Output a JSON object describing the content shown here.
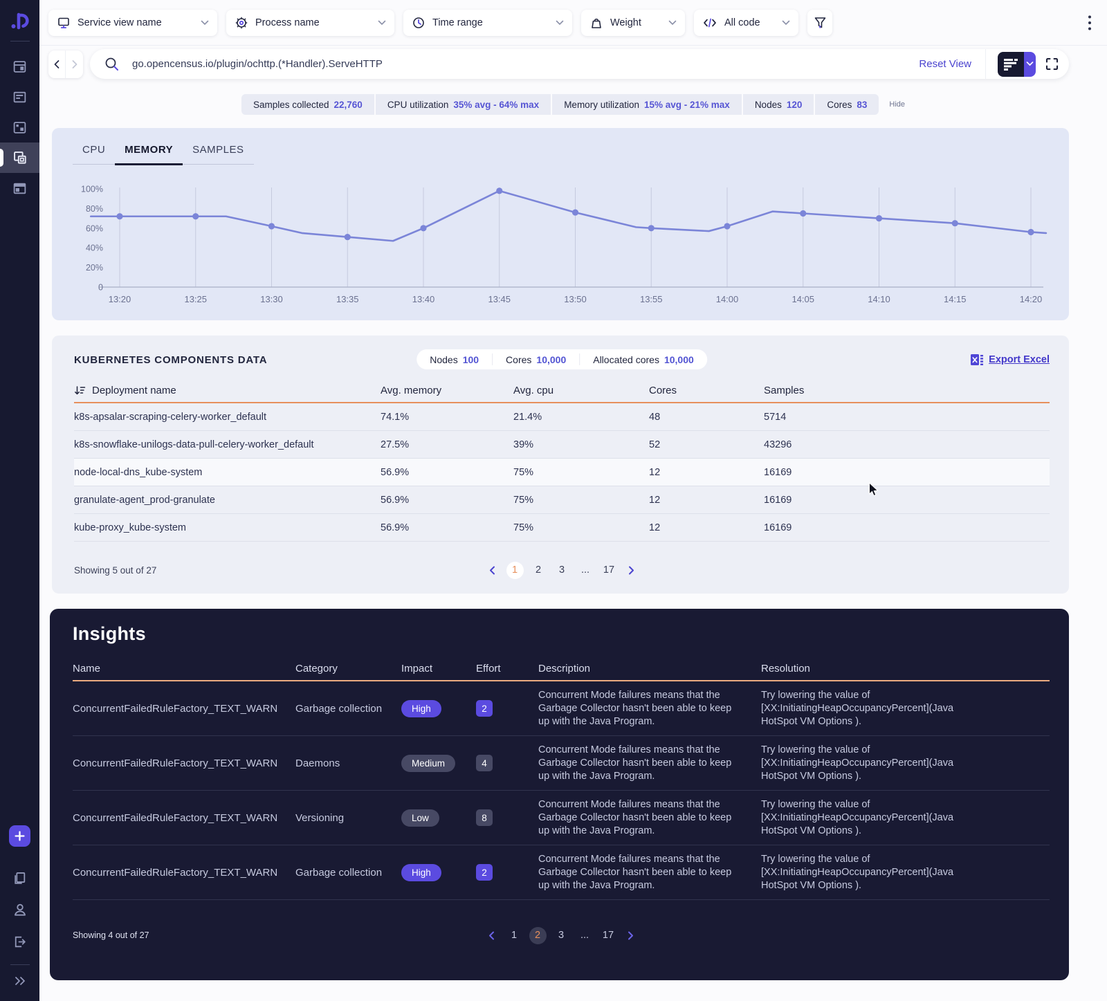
{
  "colors": {
    "accent_purple": "#5b4be0",
    "link_purple": "#4a43cf",
    "orange": "#e78f5c",
    "sidebar_navy": "#171930",
    "insights_bg": "#191a33",
    "chart_line": "#7b85d8",
    "stat_value_purple": "#5655d4"
  },
  "topbar": {
    "filters": [
      {
        "label": "Service view name",
        "icon": "monitor-icon"
      },
      {
        "label": "Process name",
        "icon": "gear-icon"
      },
      {
        "label": "Time range",
        "icon": "clock-icon"
      },
      {
        "label": "Weight",
        "icon": "weight-icon"
      },
      {
        "label": "All code",
        "icon": "code-icon"
      }
    ],
    "filter_button_icon": "funnel-icon",
    "menu_icon": "kebab-menu-icon"
  },
  "searchbar": {
    "query": "go.opencensus.io/plugin/ochttp.(*Handler).ServeHTTP",
    "reset_label": "Reset View"
  },
  "stats": {
    "items": [
      {
        "label": "Samples collected",
        "value": "22,760"
      },
      {
        "label": "CPU utilization",
        "value": "35% avg - 64% max"
      },
      {
        "label": "Memory utilization",
        "value": "15% avg - 21% max"
      },
      {
        "label": "Nodes",
        "value": "120"
      },
      {
        "label": "Cores",
        "value": "83"
      }
    ],
    "hide_label": "Hide"
  },
  "chart": {
    "tabs": [
      "CPU",
      "MEMORY",
      "SAMPLES"
    ],
    "active_tab": "MEMORY",
    "chart_data": {
      "type": "line",
      "series_name": "Memory utilization",
      "unit": "%",
      "ylim": [
        0,
        100
      ],
      "grid": "vertical",
      "line_color": "#7b85d8",
      "y_ticks": [
        {
          "label": "100%",
          "value": 100
        },
        {
          "label": "80%",
          "value": 80
        },
        {
          "label": "60%",
          "value": 60
        },
        {
          "label": "40%",
          "value": 40
        },
        {
          "label": "20%",
          "value": 20
        },
        {
          "label": "0",
          "value": 0
        }
      ],
      "x_ticks": [
        "13:20",
        "13:25",
        "13:30",
        "13:35",
        "13:40",
        "13:45",
        "13:50",
        "13:55",
        "14:00",
        "14:05",
        "14:10",
        "14:15",
        "14:20"
      ],
      "points": [
        {
          "t": "13:20",
          "v": 72
        },
        {
          "t": "13:25",
          "v": 72
        },
        {
          "t": "13:30",
          "v": 62
        },
        {
          "t": "13:35",
          "v": 51
        },
        {
          "t": "13:40",
          "v": 60
        },
        {
          "t": "13:45",
          "v": 98
        },
        {
          "t": "13:50",
          "v": 76
        },
        {
          "t": "13:55",
          "v": 60
        },
        {
          "t": "14:00",
          "v": 62
        },
        {
          "t": "14:05",
          "v": 75
        },
        {
          "t": "14:10",
          "v": 70
        },
        {
          "t": "14:15",
          "v": 65
        },
        {
          "t": "14:20",
          "v": 56
        }
      ],
      "polyline": [
        [
          -1.9,
          72,
          0
        ],
        [
          0,
          72,
          1
        ],
        [
          5,
          72,
          1
        ],
        [
          7,
          72,
          0
        ],
        [
          10,
          62,
          1
        ],
        [
          12,
          55,
          0
        ],
        [
          15,
          51,
          1
        ],
        [
          18,
          47,
          0
        ],
        [
          20,
          60,
          1
        ],
        [
          25,
          98,
          1
        ],
        [
          30,
          76,
          1
        ],
        [
          34,
          61,
          0
        ],
        [
          35,
          60,
          1
        ],
        [
          38.8,
          57,
          0
        ],
        [
          40,
          62,
          1
        ],
        [
          43,
          77,
          0
        ],
        [
          45,
          75,
          1
        ],
        [
          50,
          70,
          1
        ],
        [
          55,
          65,
          1
        ],
        [
          60,
          56,
          1
        ],
        [
          61,
          55,
          0
        ]
      ]
    }
  },
  "k8s": {
    "title": "KUBERNETES COMPONENTS DATA",
    "summary": [
      {
        "label": "Nodes",
        "value": "100"
      },
      {
        "label": "Cores",
        "value": "10,000"
      },
      {
        "label": "Allocated cores",
        "value": "10,000"
      }
    ],
    "export_label": "Export Excel",
    "columns": [
      "Deployment name",
      "Avg. memory",
      "Avg. cpu",
      "Cores",
      "Samples"
    ],
    "rows": [
      {
        "name": "k8s-apsalar-scraping-celery-worker_default",
        "memory": "74.1%",
        "cpu": "21.4%",
        "cores": "48",
        "samples": "5714",
        "highlight": false
      },
      {
        "name": "k8s-snowflake-unilogs-data-pull-celery-worker_default",
        "memory": "27.5%",
        "cpu": "39%",
        "cores": "52",
        "samples": "43296",
        "highlight": false
      },
      {
        "name": "node-local-dns_kube-system",
        "memory": "56.9%",
        "cpu": "75%",
        "cores": "12",
        "samples": "16169",
        "highlight": true
      },
      {
        "name": "granulate-agent_prod-granulate",
        "memory": "56.9%",
        "cpu": "75%",
        "cores": "12",
        "samples": "16169",
        "highlight": false
      },
      {
        "name": "kube-proxy_kube-system",
        "memory": "56.9%",
        "cpu": "75%",
        "cores": "12",
        "samples": "16169",
        "highlight": false
      }
    ],
    "showing": "Showing 5 out of 27",
    "pagination": {
      "pages": [
        {
          "label": "1",
          "active": true
        },
        {
          "label": "2",
          "active": false
        },
        {
          "label": "3",
          "active": false
        },
        {
          "label": "...",
          "active": false
        },
        {
          "label": "17",
          "active": false
        }
      ]
    }
  },
  "insights": {
    "title": "Insights",
    "columns": [
      "Name",
      "Category",
      "Impact",
      "Effort",
      "Description",
      "Resolution"
    ],
    "rows": [
      {
        "name": "ConcurrentFailedRuleFactory_TEXT_WARN",
        "category": "Garbage collection",
        "impact": "High",
        "effort": "2",
        "description": "Concurrent Mode failures means that the Garbage Collector hasn't been able to keep up with the Java Program.",
        "resolution": "Try lowering the value of [XX:InitiatingHeapOccupancyPercent](Java HotSpot VM Options )."
      },
      {
        "name": "ConcurrentFailedRuleFactory_TEXT_WARN",
        "category": "Daemons",
        "impact": "Medium",
        "effort": "4",
        "description": "Concurrent Mode failures means that the Garbage Collector hasn't been able to keep up with the Java Program.",
        "resolution": "Try lowering the value of [XX:InitiatingHeapOccupancyPercent](Java HotSpot VM Options )."
      },
      {
        "name": "ConcurrentFailedRuleFactory_TEXT_WARN",
        "category": "Versioning",
        "impact": "Low",
        "effort": "8",
        "description": "Concurrent Mode failures means that the Garbage Collector hasn't been able to keep up with the Java Program.",
        "resolution": "Try lowering the value of [XX:InitiatingHeapOccupancyPercent](Java HotSpot VM Options )."
      },
      {
        "name": "ConcurrentFailedRuleFactory_TEXT_WARN",
        "category": "Garbage collection",
        "impact": "High",
        "effort": "2",
        "description": "Concurrent Mode failures means that the Garbage Collector hasn't been able to keep up with the Java Program.",
        "resolution": "Try lowering the value of [XX:InitiatingHeapOccupancyPercent](Java HotSpot VM Options )."
      }
    ],
    "showing": "Showing 4 out of 27",
    "pagination": {
      "pages": [
        {
          "label": "1",
          "active": false
        },
        {
          "label": "2",
          "active": true
        },
        {
          "label": "3",
          "active": false
        },
        {
          "label": "...",
          "active": false
        },
        {
          "label": "17",
          "active": false
        }
      ]
    }
  }
}
